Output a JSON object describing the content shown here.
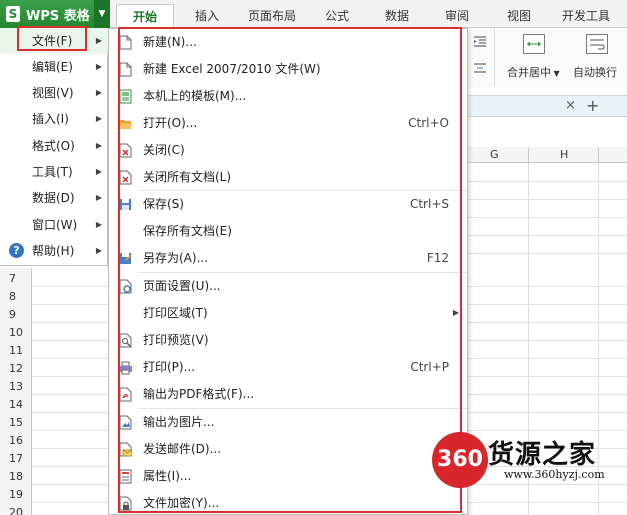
{
  "app": {
    "title": "WPS 表格",
    "logo_letter": "S"
  },
  "tabs": [
    "开始",
    "插入",
    "页面布局",
    "公式",
    "数据",
    "审阅",
    "视图",
    "开发工具"
  ],
  "ribbon": {
    "merge_label": "合并居中",
    "wrap_label": "自动换行"
  },
  "docbar": {
    "close_glyph": "×",
    "add_glyph": "+"
  },
  "columns": [
    "G",
    "H"
  ],
  "rows": [
    "7",
    "8",
    "9",
    "10",
    "11",
    "12",
    "13",
    "14",
    "15",
    "16",
    "17",
    "18",
    "19",
    "20"
  ],
  "left_menu": [
    {
      "label": "文件(F)",
      "has_submenu": true,
      "selected": true
    },
    {
      "label": "编辑(E)",
      "has_submenu": true
    },
    {
      "label": "视图(V)",
      "has_submenu": true
    },
    {
      "label": "插入(I)",
      "has_submenu": true
    },
    {
      "label": "格式(O)",
      "has_submenu": true
    },
    {
      "label": "工具(T)",
      "has_submenu": true
    },
    {
      "label": "数据(D)",
      "has_submenu": true
    },
    {
      "label": "窗口(W)",
      "has_submenu": true
    },
    {
      "label": "帮助(H)",
      "has_submenu": true,
      "icon": "help-icon"
    }
  ],
  "file_menu": [
    {
      "label": "新建(N)...",
      "shortcut": "",
      "icon": "new-doc-icon"
    },
    {
      "label": "新建 Excel 2007/2010 文件(W)",
      "shortcut": "",
      "icon": "new-doc-icon"
    },
    {
      "label": "本机上的模板(M)...",
      "shortcut": "",
      "icon": "template-icon"
    },
    {
      "label": "打开(O)...",
      "shortcut": "Ctrl+O",
      "icon": "open-folder-icon"
    },
    {
      "label": "关闭(C)",
      "shortcut": "",
      "icon": "close-doc-icon"
    },
    {
      "label": "关闭所有文档(L)",
      "shortcut": "",
      "icon": "close-all-icon"
    },
    {
      "label": "保存(S)",
      "shortcut": "Ctrl+S",
      "icon": "save-icon"
    },
    {
      "label": "保存所有文档(E)",
      "shortcut": "",
      "icon": ""
    },
    {
      "label": "另存为(A)...",
      "shortcut": "F12",
      "icon": "save-as-icon"
    },
    {
      "label": "页面设置(U)...",
      "shortcut": "",
      "icon": "page-setup-icon"
    },
    {
      "label": "打印区域(T)",
      "shortcut": "",
      "icon": "",
      "has_submenu": true
    },
    {
      "label": "打印预览(V)",
      "shortcut": "",
      "icon": "print-preview-icon"
    },
    {
      "label": "打印(P)...",
      "shortcut": "Ctrl+P",
      "icon": "print-icon"
    },
    {
      "label": "输出为PDF格式(F)...",
      "shortcut": "",
      "icon": "pdf-icon"
    },
    {
      "label": "输出为图片...",
      "shortcut": "",
      "icon": "image-export-icon"
    },
    {
      "label": "发送邮件(D)...",
      "shortcut": "",
      "icon": "mail-icon"
    },
    {
      "label": "属性(I)...",
      "shortcut": "",
      "icon": "properties-icon"
    },
    {
      "label": "文件加密(Y)...",
      "shortcut": "",
      "icon": "encrypt-icon"
    }
  ],
  "watermark": {
    "badge": "360",
    "title": "货源之家",
    "url": "www.360hyzj.com"
  },
  "colors": {
    "brand_green": "#2a8a35",
    "annotation_red": "#d92f2f",
    "watermark_red": "#d8262a"
  }
}
